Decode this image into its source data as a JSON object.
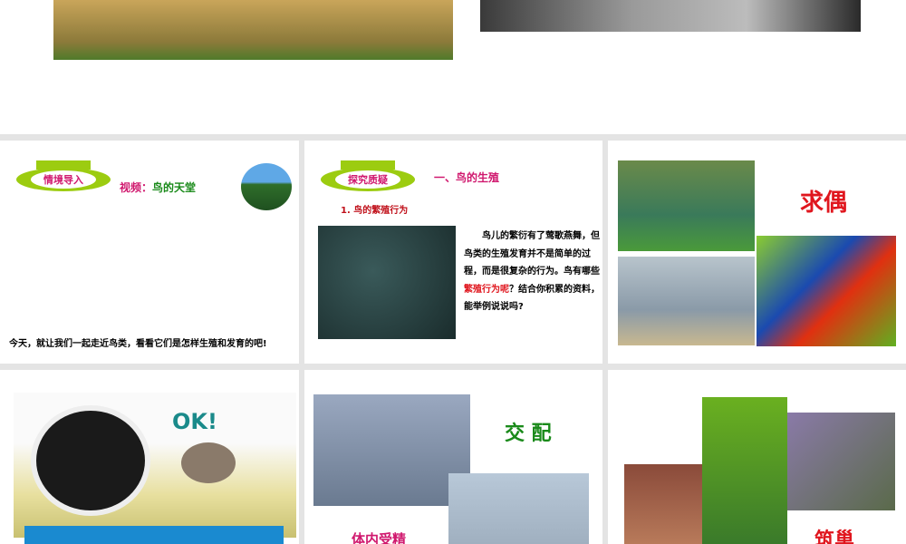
{
  "slides": [
    {
      "id": "top-partial"
    },
    {
      "badge": "情境导入",
      "title_prefix": "视频：",
      "title": "鸟的天堂",
      "caption": "今天，就让我们一起走近鸟类，看看它们是怎样生殖和发育的吧!"
    },
    {
      "badge": "探究质疑",
      "heading": "一、鸟的生殖",
      "subheading": "1. 鸟的繁殖行为",
      "para_1": "鸟儿的繁衍有了莺歌燕舞，但鸟类的生殖发育并不是简单的过程，而是很复杂的行为。鸟有哪些",
      "para_highlight": "繁殖行为呢",
      "para_2": "？结合你积累的资料，能举例说说吗?"
    },
    {
      "label": "求偶"
    },
    {
      "label": "OK!"
    },
    {
      "label_1": "交 配",
      "label_2": "体内受精"
    },
    {
      "label": "筑巢"
    }
  ],
  "colors": {
    "magenta": "#d0186e",
    "green": "#1a8a1a",
    "red": "#e0161e",
    "badge": "#9ccc10"
  }
}
